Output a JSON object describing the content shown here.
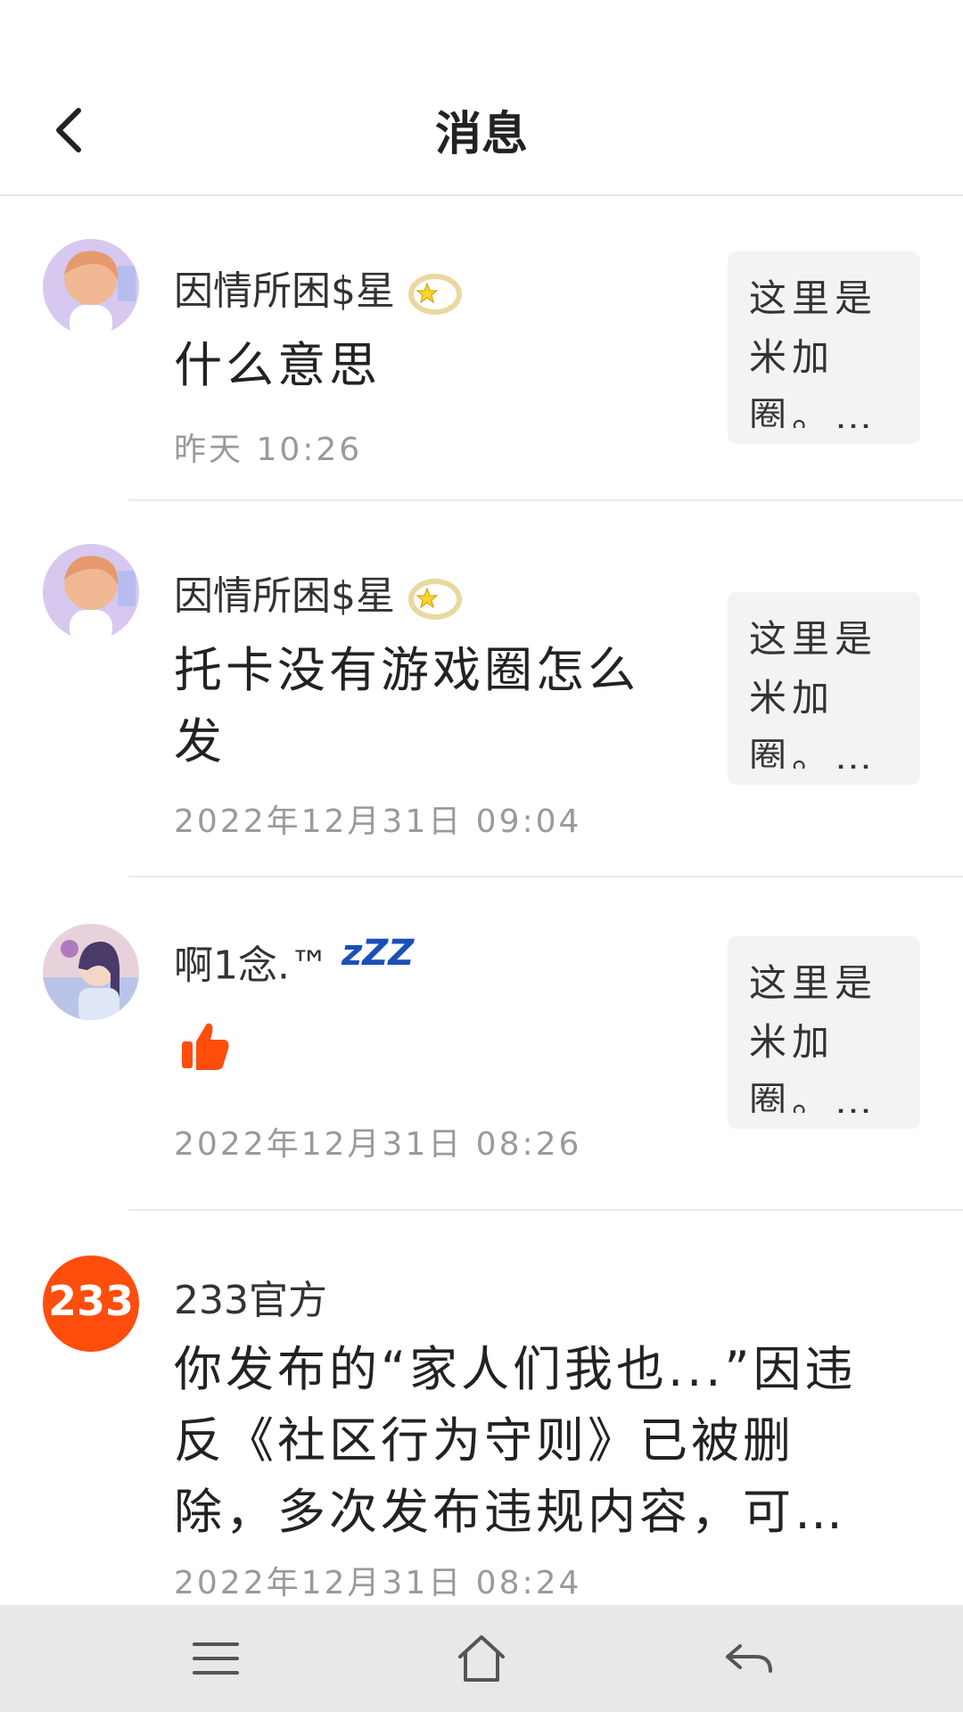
{
  "header": {
    "title": "消息"
  },
  "messages": [
    {
      "name": "因情所困$星",
      "text": "什么意思",
      "time": "昨天 10:26",
      "thumb_text": "这里是米加圈。…"
    },
    {
      "name": "因情所困$星",
      "text": "托卡没有游戏圈怎么发",
      "time": "2022年12月31日 09:04",
      "thumb_text": "这里是米加圈。…"
    },
    {
      "name": "啊1念.™",
      "name_suffix": "zZZ",
      "text": "",
      "time": "2022年12月31日 08:26",
      "thumb_text": "这里是米加圈。…"
    },
    {
      "name": "233官方",
      "avatar_text": "233",
      "text": "你发布的“家人们我也...”因违反《社区行为守则》已被删除，多次发布违规内容，可…",
      "time": "2022年12月31日 08:24"
    }
  ],
  "colors": {
    "brand_orange": "#ff4d0d",
    "thumb_bg": "#f3f3f3",
    "navbar_bg": "#e8e8e8"
  },
  "icons": {
    "back": "chevron-left-icon",
    "halo": "halo-star-icon",
    "like": "thumbs-up-icon",
    "menu": "menu-icon",
    "home": "home-icon",
    "nav_back": "return-icon"
  }
}
